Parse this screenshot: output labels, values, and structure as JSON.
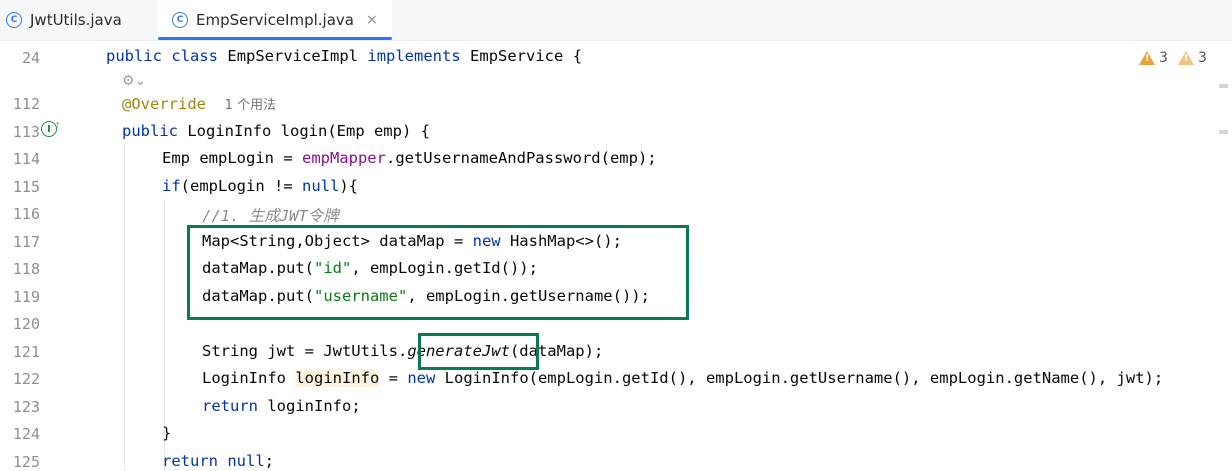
{
  "tabs": [
    {
      "label": "JwtUtils.java",
      "icon": "class-icon",
      "icon_glyph": "C",
      "active": false
    },
    {
      "label": "EmpServiceImpl.java",
      "icon": "class-icon",
      "icon_glyph": "C",
      "active": true,
      "close": "×"
    }
  ],
  "gutter": {
    "lines": [
      "24",
      "112",
      "113",
      "114",
      "115",
      "116",
      "117",
      "118",
      "119",
      "120",
      "121",
      "122",
      "123",
      "124",
      "125"
    ]
  },
  "inspections": {
    "warnings_count": "3",
    "weak_warnings_count": "3"
  },
  "code": {
    "l24": {
      "kw1": "public",
      "kw2": "class",
      "name": "EmpServiceImpl",
      "kw3": "implements",
      "iface": "EmpService",
      "brace": "{"
    },
    "l112": {
      "annotation": "@Override",
      "usages": "1 个用法"
    },
    "l113": {
      "kw": "public",
      "rest": "LoginInfo login(Emp emp) {"
    },
    "l114": {
      "pre": "Emp empLogin = ",
      "field": "empMapper",
      "post": ".getUsernameAndPassword(emp);"
    },
    "l115": {
      "kw1": "if",
      "mid": "(empLogin != ",
      "kw2": "null",
      "post": "){"
    },
    "l116": {
      "comment": "//1. 生成JWT令牌"
    },
    "l117": {
      "pre": "Map<String,Object> dataMap = ",
      "kw": "new",
      "post": " HashMap<>();"
    },
    "l118": {
      "pre": "dataMap.put(",
      "str": "\"id\"",
      "post": ", empLogin.getId());"
    },
    "l119": {
      "pre": "dataMap.put(",
      "str": "\"username\"",
      "post": ", empLogin.getUsername());"
    },
    "l121": {
      "pre": "String jwt = JwtUtils.",
      "method": "generateJwt",
      "post": "(dataMap);"
    },
    "l122": {
      "pre": "LoginInfo ",
      "var": "loginInfo",
      "mid": " = ",
      "kw": "new",
      "post": " LoginInfo(empLogin.getId(), empLogin.getUsername(), empLogin.getName(), jwt);"
    },
    "l123": {
      "kw": "return",
      "post": " loginInfo;"
    },
    "l124": {
      "brace": "}"
    },
    "l125": {
      "kw": "return",
      "mid": " ",
      "kw2": "null",
      "post": ";"
    }
  },
  "colors": {
    "keyword": "#0033b3",
    "string": "#067d17",
    "field": "#871094",
    "comment": "#8c8c8c",
    "annotation": "#9e880d",
    "highlight_box": "#0b7a51",
    "tab_accent": "#3574f0"
  }
}
